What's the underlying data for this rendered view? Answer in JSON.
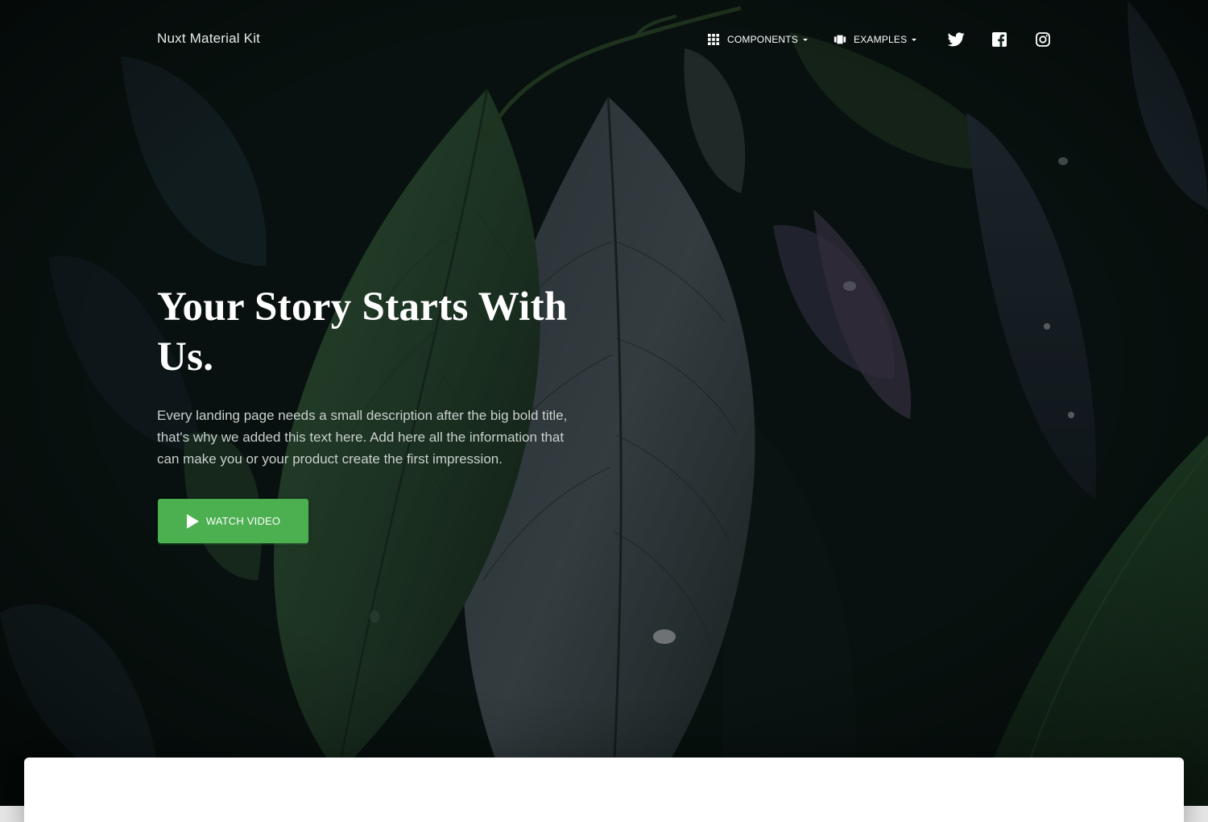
{
  "brand": {
    "name": "Nuxt Material Kit"
  },
  "nav": {
    "items": [
      {
        "label": "COMPONENTS",
        "icon": "apps-grid-icon",
        "has_dropdown": true
      },
      {
        "label": "EXAMPLES",
        "icon": "view-carousel-icon",
        "has_dropdown": true
      }
    ],
    "social": [
      {
        "icon": "twitter-icon"
      },
      {
        "icon": "facebook-icon"
      },
      {
        "icon": "instagram-icon"
      }
    ]
  },
  "hero": {
    "title": "Your Story Starts With Us.",
    "description": "Every landing page needs a small description after the big bold title, that's why we added this text here. Add here all the information that can make you or your product create the first impression.",
    "button_label": "WATCH VIDEO",
    "button_icon": "play-arrow-icon"
  },
  "colors": {
    "accent": "#4caf50",
    "background": "#0c1a17",
    "text": "#ffffff",
    "card": "#ffffff"
  }
}
